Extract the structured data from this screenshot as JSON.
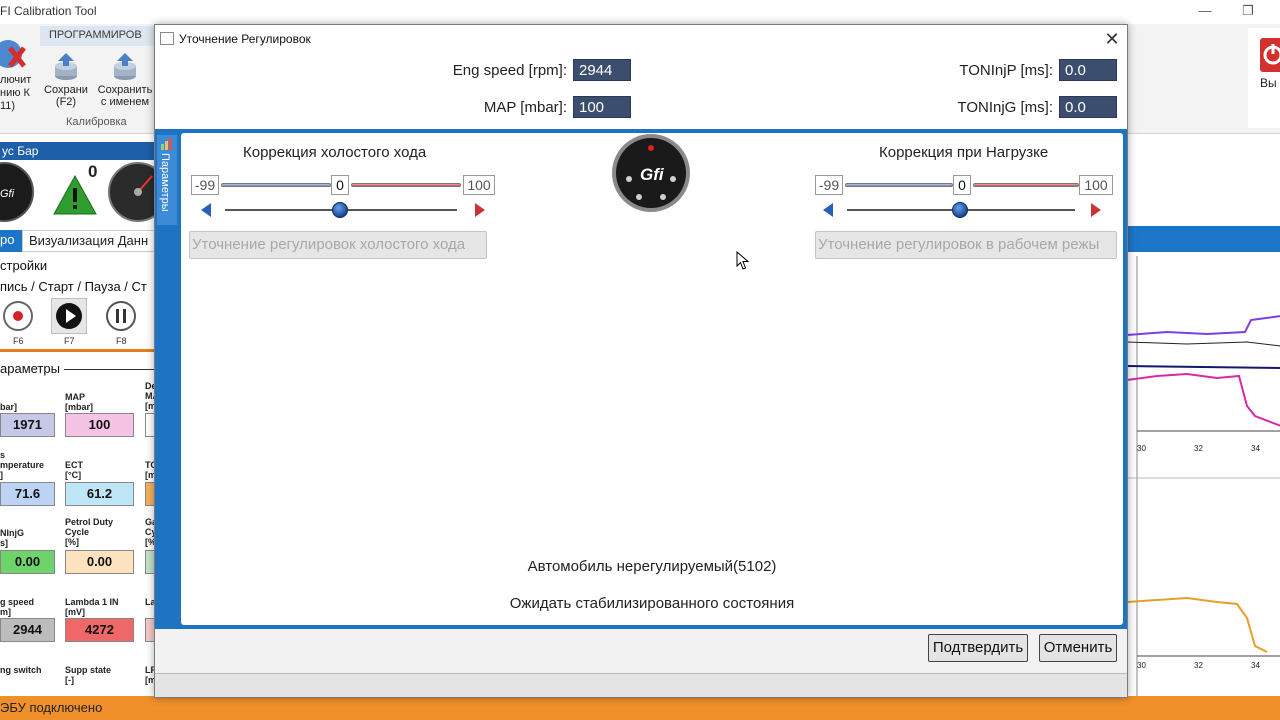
{
  "app": {
    "title": "FI Calibration Tool",
    "ribbon_tab": "ПРОГРАММИРОВ",
    "left_button_text": "лючит\nнию К\n11)",
    "save_button": "Сохрани\n(F2)",
    "save_as_button": "Сохранить\nс именем",
    "group_label": "Калибровка",
    "right_button_text": "Вы",
    "status_head": "ус Бар",
    "warning_count": "0",
    "tab_active": "ро",
    "tab_visualization": "Визуализация Данн",
    "settings_label": "стройки",
    "record_label": "пись / Старт / Пауза / Ст",
    "fkeys": [
      "F6",
      "F7",
      "F8"
    ],
    "params_label": "араметры",
    "status_text": "ЭБУ подключено",
    "params": [
      {
        "label": "bar]",
        "value": "1971",
        "color": "#c5c8e6"
      },
      {
        "label": "MAP\n[mbar]",
        "value": "100",
        "color": "#f5c3e3"
      },
      {
        "label": "s\nmperature\n]",
        "value": "71.6",
        "color": "#bcd3f5"
      },
      {
        "label": "ECT\n[°C]",
        "value": "61.2",
        "color": "#bfe6f7"
      },
      {
        "label": "NInjG\ns]",
        "value": "0.00",
        "color": "#6ed36b"
      },
      {
        "label": "Petrol Duty\nCycle\n[%]",
        "value": "0.00",
        "color": "#fde2bf"
      },
      {
        "label": "g speed\nm]",
        "value": "2944",
        "color": "#bcbcbc"
      },
      {
        "label": "Lambda 1 IN\n[mV]",
        "value": "4272",
        "color": "#f06767"
      },
      {
        "label": "ng switch",
        "value": "",
        "color": ""
      },
      {
        "label": "Supp state\n[-]",
        "value": "",
        "color": ""
      }
    ],
    "partial_labels": [
      "De\nMA\n[m",
      "TO\n[m",
      "Ga\nCy\n[%",
      "La",
      "LP\n[m"
    ],
    "chart_ticks": [
      "30",
      "32",
      "34"
    ]
  },
  "dialog": {
    "title": "Уточнение Регулировок",
    "readouts": [
      {
        "label": "Eng speed [rpm]:",
        "value": "2944"
      },
      {
        "label": "MAP [mbar]:",
        "value": "100"
      },
      {
        "label": "TONInjP [ms]:",
        "value": "0.0"
      },
      {
        "label": "TONInjG [ms]:",
        "value": "0.0"
      }
    ],
    "side_tab": "Параметры",
    "logo_text": "Gfi",
    "idle": {
      "title": "Коррекция холостого хода",
      "min": "-99",
      "value": "0",
      "max": "100",
      "button": "Уточнение регулировок холостого хода"
    },
    "load": {
      "title": "Коррекция при Нагрузке",
      "min": "-99",
      "value": "0",
      "max": "100",
      "button": "Уточнение регулировок в рабочем режы"
    },
    "message1": "Автомобиль нерегулируемый(5102)",
    "message2": "Ожидать стабилизированного состояния",
    "confirm_button": "Подтвердить",
    "cancel_button": "Отменить"
  }
}
